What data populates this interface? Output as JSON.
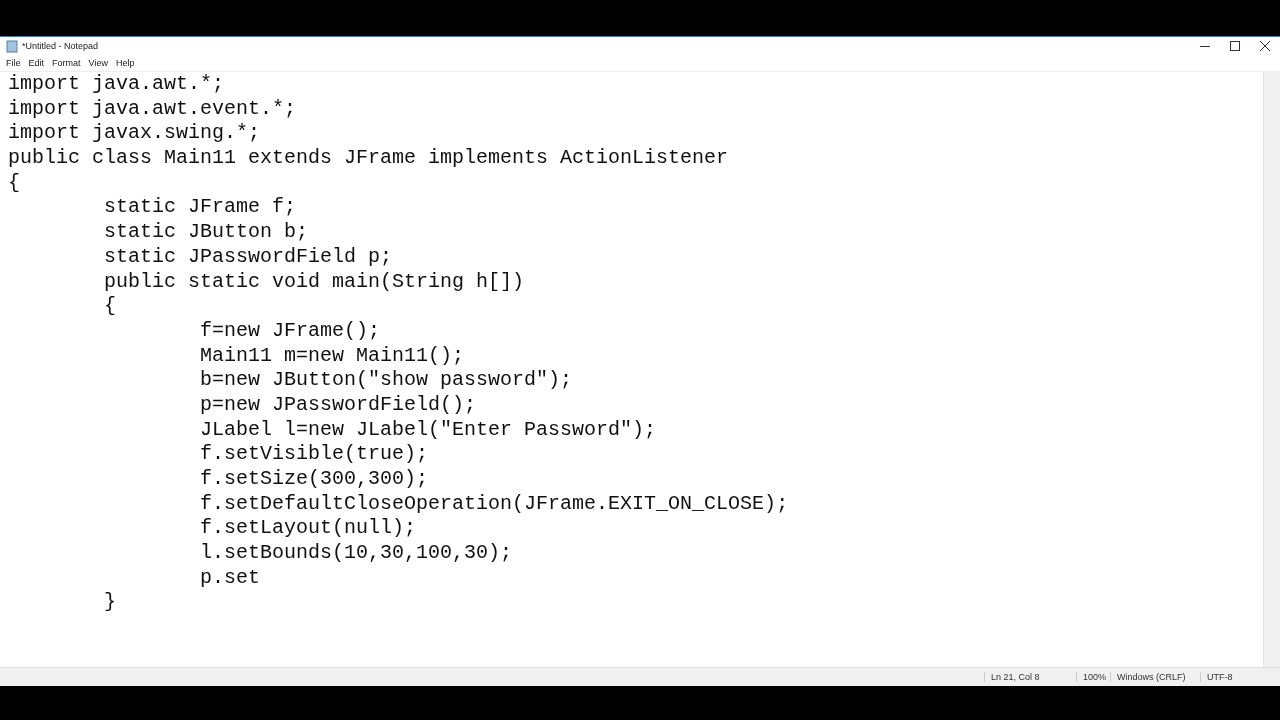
{
  "window": {
    "title": "*Untitled - Notepad"
  },
  "menu": [
    "File",
    "Edit",
    "Format",
    "View",
    "Help"
  ],
  "editor": {
    "lines": [
      "import java.awt.*;",
      "import java.awt.event.*;",
      "import javax.swing.*;",
      "public class Main11 extends JFrame implements ActionListener",
      "{",
      "\tstatic JFrame f;",
      "\tstatic JButton b;",
      "\tstatic JPasswordField p;",
      "\tpublic static void main(String h[])",
      "\t{",
      "\t\tf=new JFrame();",
      "\t\tMain11 m=new Main11();",
      "\t\tb=new JButton(\"show password\");",
      "\t\tp=new JPasswordField();",
      "\t\tJLabel l=new JLabel(\"Enter Password\");",
      "\t\tf.setVisible(true);",
      "\t\tf.setSize(300,300);",
      "\t\tf.setDefaultCloseOperation(JFrame.EXIT_ON_CLOSE);",
      "\t\tf.setLayout(null);",
      "\t\tl.setBounds(10,30,100,30);",
      "\t\tp.set",
      "\t}"
    ]
  },
  "status_bar": [
    "Ln 21, Col 8",
    "100%",
    "Windows (CRLF)",
    "UTF-8"
  ]
}
